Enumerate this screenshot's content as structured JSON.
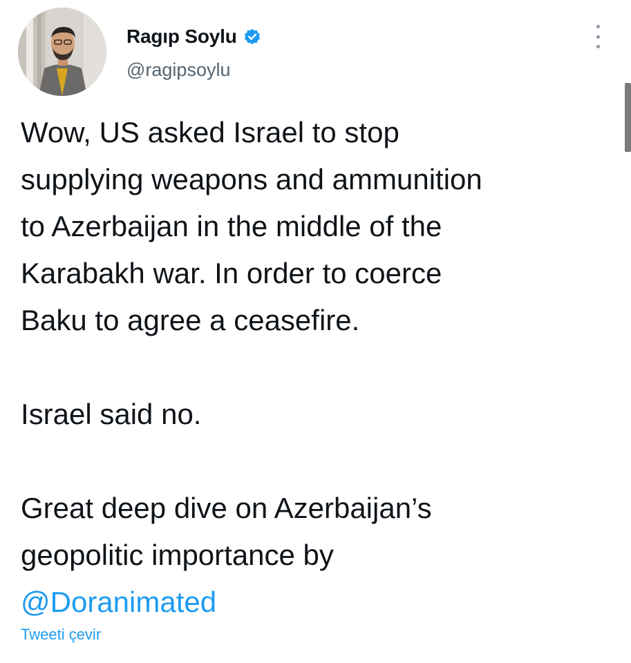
{
  "author": {
    "display_name": "Ragıp Soylu",
    "handle": "@ragipsoylu",
    "verified": true,
    "avatar_icon": "user-avatar-photo",
    "verified_icon": "verified-badge-icon"
  },
  "tweet": {
    "lines_1": [
      "Wow, US asked Israel to stop",
      "supplying weapons and ammunition",
      "to Azerbaijan in the middle of the",
      "Karabakh war. In order to coerce",
      "Baku to agree a ceasefire."
    ],
    "line_2": "Israel said no.",
    "lines_3": [
      "Great deep dive on Azerbaijan’s",
      "geopolitic importance by"
    ],
    "mention": "@Doranimated"
  },
  "translate_label": "Tweeti çevir",
  "colors": {
    "accent": "#1d9bf0",
    "text": "#0f1419",
    "secondary": "#536471"
  }
}
